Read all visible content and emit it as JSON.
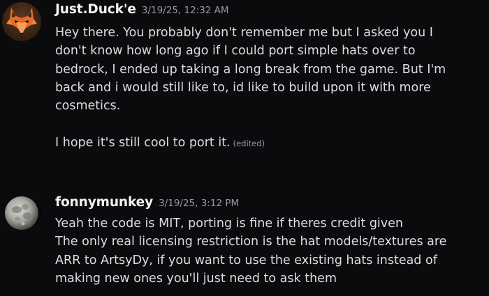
{
  "messages": [
    {
      "username": "Just.Duck'e",
      "timestamp": "3/19/25, 12:32 AM",
      "avatar_icon": "fox-avatar",
      "lines": [
        "Hey there. You probably don't remember me but I asked you I",
        "don't know how long ago if I could port simple hats over to",
        "bedrock, I ended up taking a long break from the game. But I'm",
        "back and i would still like to, id like to build upon it with more",
        "cosmetics.",
        "I hope it's still cool to port it."
      ],
      "edited_label": "(edited)"
    },
    {
      "username": "fonnymunkey",
      "timestamp": "3/19/25, 3:12 PM",
      "avatar_icon": "moon-avatar",
      "lines": [
        "Yeah the code is MIT, porting is fine if theres credit given",
        "The only real licensing restriction is the hat models/textures are",
        "ARR to ArtsyDy, if you want to use the existing hats instead of",
        "making new ones you'll just need to ask them"
      ]
    }
  ],
  "colors": {
    "background": "#0b0b0d",
    "username": "#f2f3f5",
    "text": "#dbdee1",
    "muted": "#949ba4",
    "fox_orange": "#e8692a"
  }
}
